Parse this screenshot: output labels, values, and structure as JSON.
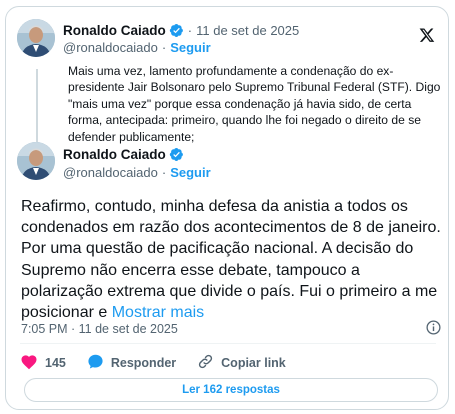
{
  "quoted_post": {
    "author_name": "Ronaldo Caiado",
    "separator": "·",
    "date": "11 de set de 2025",
    "handle": "@ronaldocaiado",
    "follow_label": "Seguir",
    "text": "Mais uma vez, lamento profundamente a condenação do ex-presidente Jair Bolsonaro pelo Supremo Tribunal Federal (STF). Digo \"mais uma vez\" porque essa condenação já havia sido, de certa forma, antecipada: primeiro, quando lhe foi negado o direito de se defender publicamente;"
  },
  "main_post": {
    "author_name": "Ronaldo Caiado",
    "handle": "@ronaldocaiado",
    "follow_label": "Seguir",
    "text": "Reafirmo, contudo, minha defesa da anistia a todos os condenados em razão dos acontecimentos de 8 de janeiro. Por uma questão de pacificação nacional. A decisão do Supremo não encerra esse debate, tampouco a polarização extrema que divide o país. Fui o primeiro a me posicionar e ",
    "show_more": "Mostrar mais",
    "timestamp": "7:05 PM · 11 de set de 2025"
  },
  "actions": {
    "likes_count": "145",
    "reply_label": "Responder",
    "copy_link_label": "Copiar link"
  },
  "read_replies_label": "Ler 162 respostas",
  "colors": {
    "accent": "#1d9bf0",
    "like": "#f91880",
    "muted": "#536471",
    "border": "#cfd9de"
  },
  "icons": [
    "x-logo-icon",
    "verified-badge-icon",
    "heart-icon",
    "reply-bubble-icon",
    "link-icon",
    "info-icon"
  ]
}
